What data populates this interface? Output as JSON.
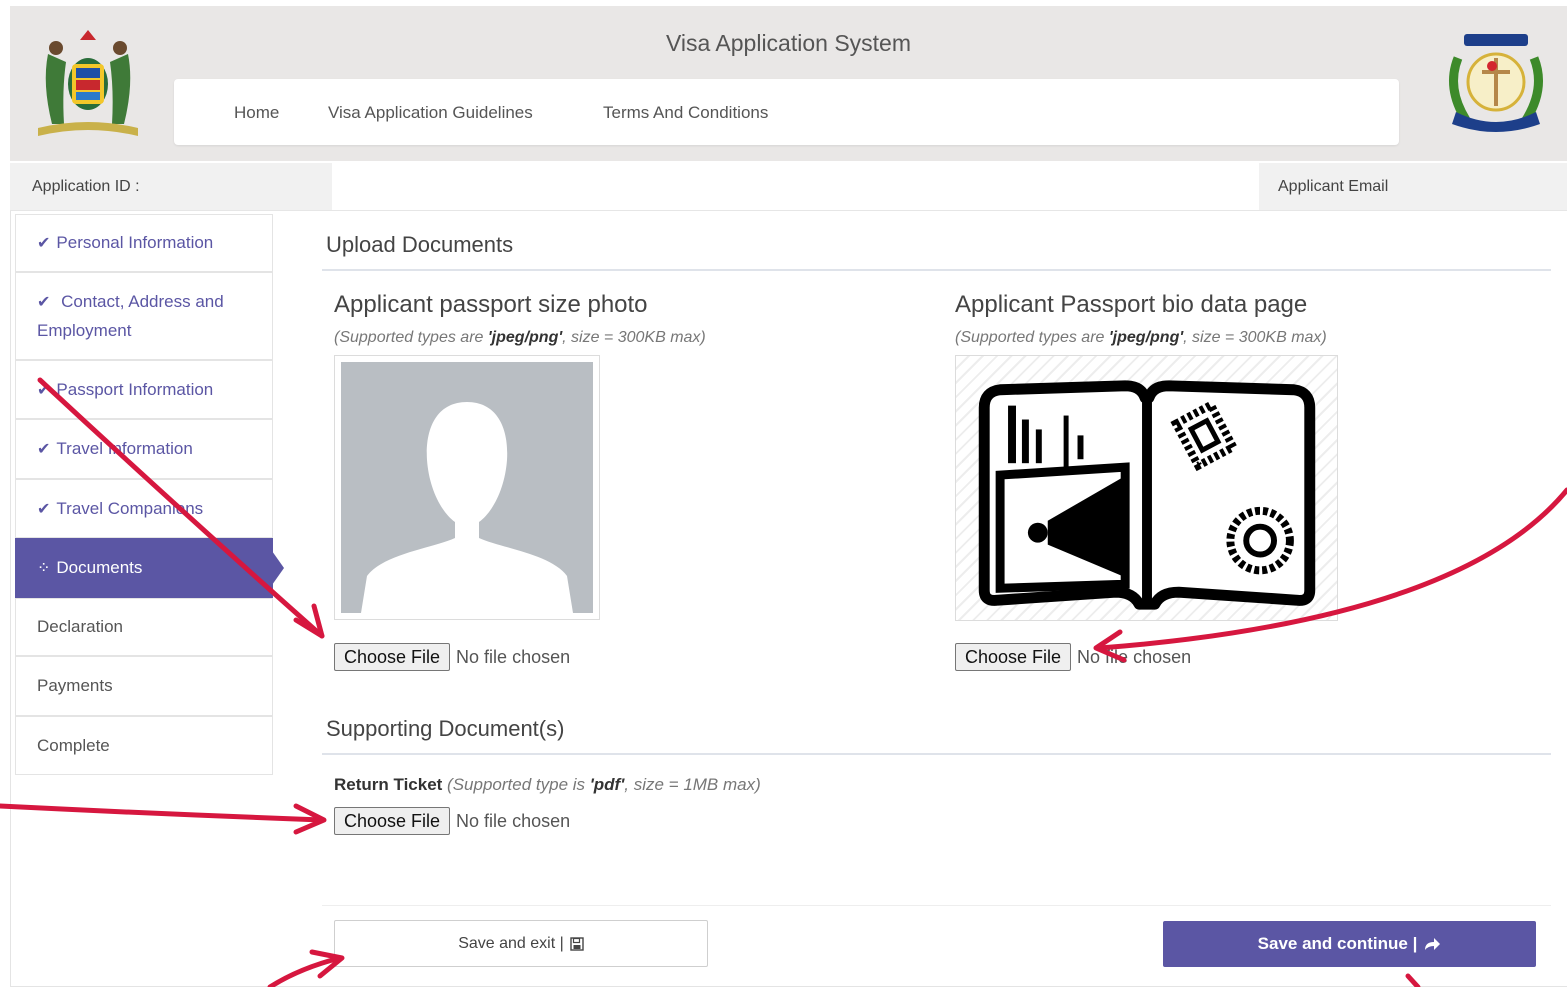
{
  "header": {
    "title": "Visa Application System",
    "nav": [
      "Home",
      "Visa Application Guidelines",
      "Terms And Conditions"
    ]
  },
  "info": {
    "application_id_label": "Application ID :",
    "applicant_email_label": "Applicant Email"
  },
  "sidebar": {
    "items": [
      {
        "label": "Personal Information",
        "state": "done"
      },
      {
        "label": "Contact, Address and Employment",
        "state": "done"
      },
      {
        "label": "Passport Information",
        "state": "done"
      },
      {
        "label": "Travel Information",
        "state": "done"
      },
      {
        "label": "Travel Companions",
        "state": "done"
      },
      {
        "label": "Documents",
        "state": "active"
      },
      {
        "label": "Declaration",
        "state": "pending"
      },
      {
        "label": "Payments",
        "state": "pending"
      },
      {
        "label": "Complete",
        "state": "pending"
      }
    ]
  },
  "upload": {
    "title": "Upload Documents",
    "photo": {
      "title": "Applicant passport size photo",
      "hint_prefix": "(Supported types are ",
      "hint_types": "'jpeg/png'",
      "hint_suffix": ", size = 300KB max)"
    },
    "passport": {
      "title": "Applicant Passport bio data page",
      "hint_prefix": "(Supported types are ",
      "hint_types": "'jpeg/png'",
      "hint_suffix": ", size = 300KB max)"
    },
    "choose_file_label": "Choose File",
    "no_file_text": "No file chosen"
  },
  "supporting": {
    "title": "Supporting Document(s)",
    "ticket_label": "Return Ticket",
    "ticket_hint_prefix": " (Supported type is ",
    "ticket_hint_type": "'pdf'",
    "ticket_hint_suffix": ", size = 1MB max)"
  },
  "actions": {
    "save_exit": "Save and exit |",
    "save_continue": "Save and continue |"
  },
  "colors": {
    "accent": "#5b56a4",
    "annotation_arrow": "#d6173f"
  },
  "icons": {
    "check": "check-icon",
    "spinner": "spinner-icon",
    "save": "floppy-disk-icon",
    "forward": "share-forward-icon"
  }
}
